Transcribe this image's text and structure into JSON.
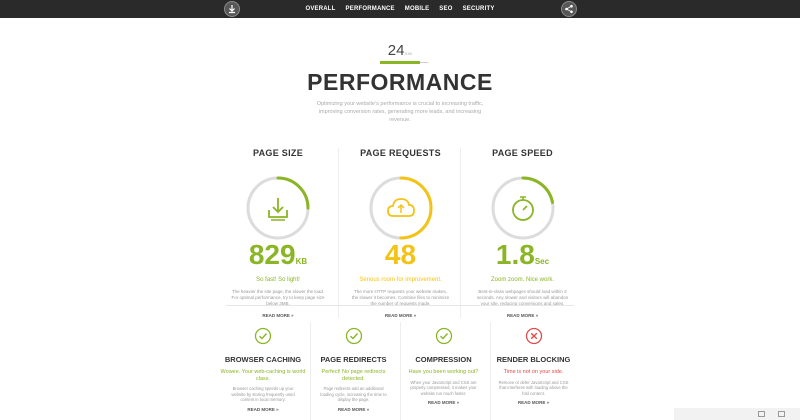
{
  "nav": {
    "items": [
      "OVERALL",
      "PERFORMANCE",
      "MOBILE",
      "SEO",
      "SECURITY"
    ],
    "active": "PERFORMANCE",
    "download_icon": "download-icon",
    "share_icon": "share-icon"
  },
  "score": {
    "value": "24",
    "of": "/100"
  },
  "title": "PERFORMANCE",
  "intro": "Optimizing your website's performance is crucial to increasing traffic, improving conversion rates, generating more leads, and increasing revenue.",
  "metrics": [
    {
      "title": "PAGE SIZE",
      "icon": "download-tray-icon",
      "value": "829",
      "unit": "KB",
      "verdict": "So fast! So light!",
      "description": "The heavier the site page, the slower the load. For optimal performance, try to keep page size below 3MB.",
      "read_more": "READ MORE »",
      "gauge_fraction": 0.25,
      "color": "#8ab524"
    },
    {
      "title": "PAGE REQUESTS",
      "icon": "cloud-icon",
      "value": "48",
      "unit": "",
      "verdict": "Serious room for improvement.",
      "description": "The more HTTP requests your website makes, the slower it becomes. Combine files to minimize the number of requests made.",
      "read_more": "READ MORE »",
      "gauge_fraction": 0.5,
      "color": "#f3c315"
    },
    {
      "title": "PAGE SPEED",
      "icon": "stopwatch-icon",
      "value": "1.8",
      "unit": "Sec",
      "verdict": "Zoom zoom. Nice work.",
      "description": "Best-in-class webpages should load within 3 seconds. Any slower and visitors will abandon your site, reducing conversions and sales.",
      "read_more": "READ MORE »",
      "gauge_fraction": 0.22,
      "color": "#8ab524"
    }
  ],
  "features": [
    {
      "title": "BROWSER CACHING",
      "icon": "check-circle-icon",
      "verdict": "Wowee. Your web-caching is world class.",
      "description": "Browser caching speeds up your website by storing frequently used content in local memory.",
      "read_more": "READ MORE »",
      "color": "#8ab524"
    },
    {
      "title": "PAGE REDIRECTS",
      "icon": "check-circle-icon",
      "verdict": "Perfect! No page redirects detected.",
      "description": "Page redirects add an additional loading cycle, increasing the time to display the page.",
      "read_more": "READ MORE »",
      "color": "#8ab524"
    },
    {
      "title": "COMPRESSION",
      "icon": "check-circle-icon",
      "verdict": "Have you been working out?",
      "description": "When your JavaScript and CSS are properly compressed, it makes your website run much faster.",
      "read_more": "READ MORE »",
      "color": "#8ab524"
    },
    {
      "title": "RENDER BLOCKING",
      "icon": "x-circle-icon",
      "verdict": "Time is not on your side.",
      "description": "Remove or defer JavaScript and CSS that interferes with loading above the fold content.",
      "read_more": "READ MORE »",
      "color": "#e04b4b"
    }
  ]
}
